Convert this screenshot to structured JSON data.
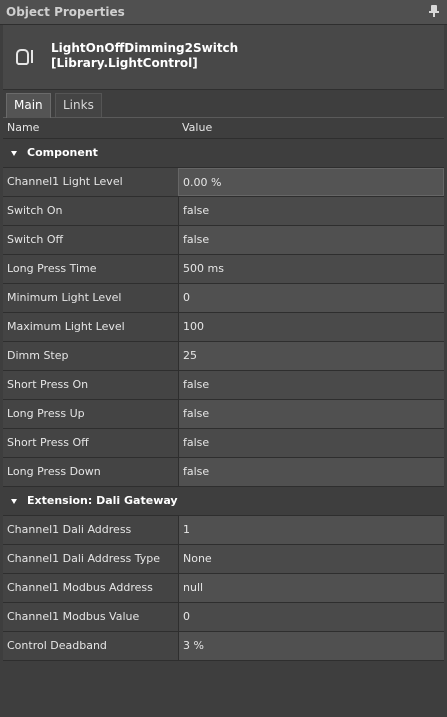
{
  "panel": {
    "title": "Object Properties"
  },
  "object": {
    "name_line1": "LightOnOffDimming2Switch",
    "name_line2": "[Library.LightControl]"
  },
  "tabs": [
    {
      "label": "Main"
    },
    {
      "label": "Links"
    }
  ],
  "grid": {
    "col_name": "Name",
    "col_value": "Value",
    "categories": [
      {
        "label": "Component",
        "properties": [
          {
            "name": "Channel1 Light Level",
            "value": "0.00 %"
          },
          {
            "name": "Switch On",
            "value": "false"
          },
          {
            "name": "Switch Off",
            "value": "false"
          },
          {
            "name": "Long Press Time",
            "value": "500 ms"
          },
          {
            "name": "Minimum Light Level",
            "value": "0"
          },
          {
            "name": "Maximum Light Level",
            "value": "100"
          },
          {
            "name": "Dimm Step",
            "value": "25"
          },
          {
            "name": "Short Press On",
            "value": "false"
          },
          {
            "name": "Long Press Up",
            "value": "false"
          },
          {
            "name": "Short Press Off",
            "value": "false"
          },
          {
            "name": "Long Press Down",
            "value": "false"
          }
        ]
      },
      {
        "label": "Extension: Dali Gateway",
        "properties": [
          {
            "name": "Channel1 Dali Address",
            "value": "1"
          },
          {
            "name": "Channel1 Dali Address Type",
            "value": "None"
          },
          {
            "name": "Channel1 Modbus Address",
            "value": "null"
          },
          {
            "name": "Channel1 Modbus Value",
            "value": "0"
          },
          {
            "name": "Control Deadband",
            "value": "3 %"
          }
        ]
      }
    ]
  }
}
